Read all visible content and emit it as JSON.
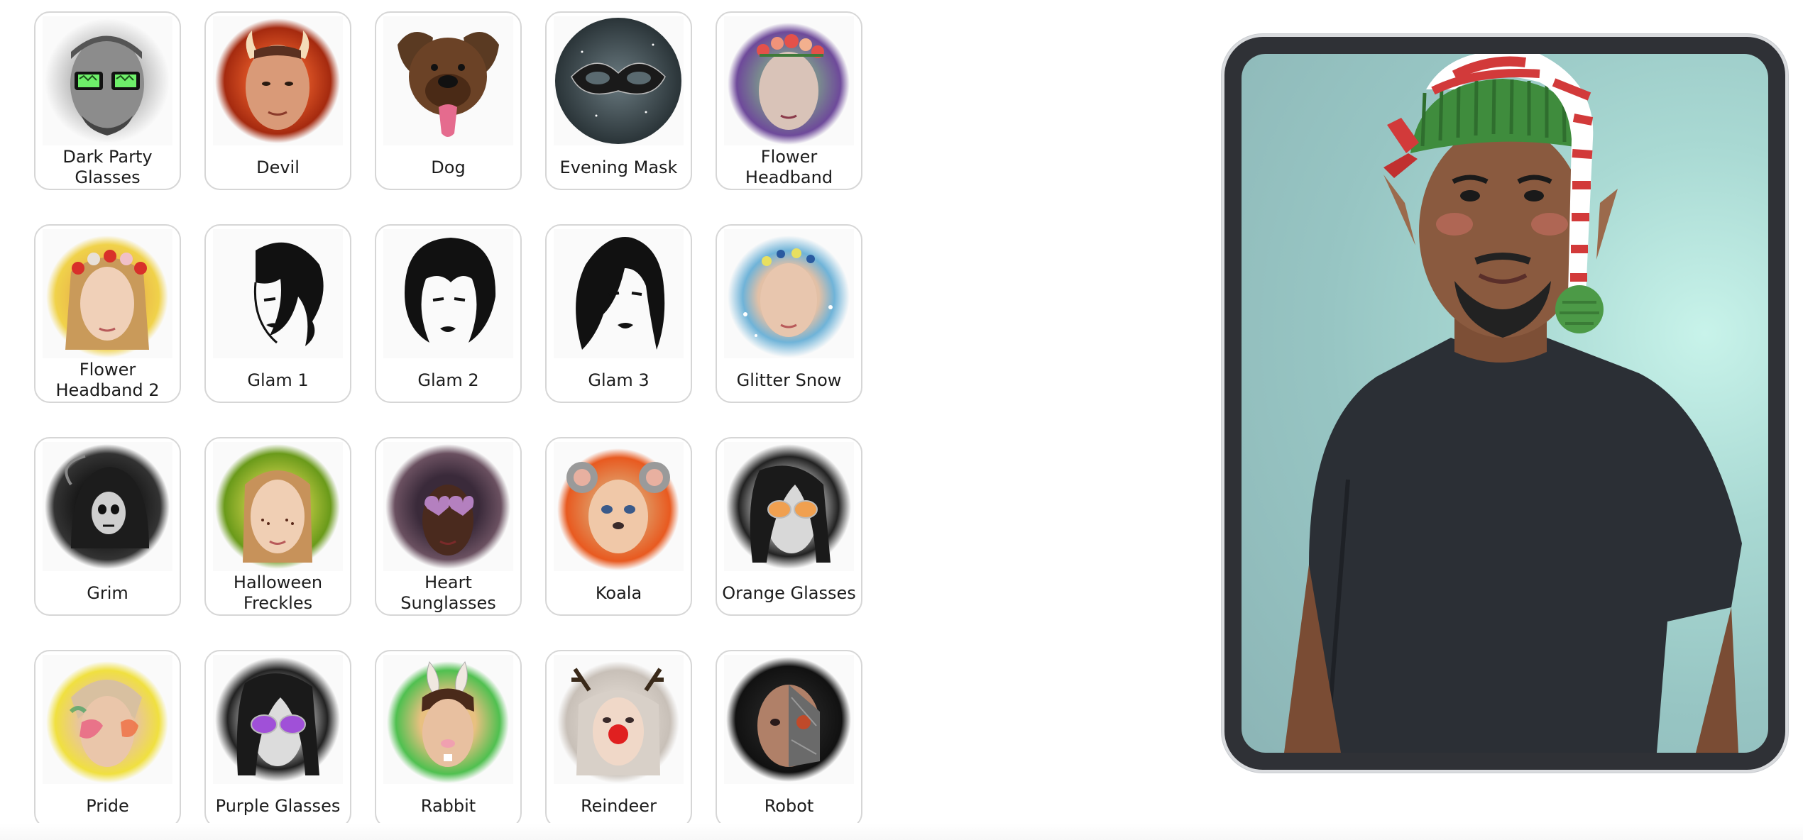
{
  "filters": [
    {
      "label": "Dark Party Glasses",
      "icon": "dark-party-glasses-icon"
    },
    {
      "label": "Devil",
      "icon": "devil-icon"
    },
    {
      "label": "Dog",
      "icon": "dog-icon"
    },
    {
      "label": "Evening Mask",
      "icon": "evening-mask-icon"
    },
    {
      "label": "Flower Headband",
      "icon": "flower-headband-icon"
    },
    {
      "label": "Flower Headband 2",
      "icon": "flower-headband-2-icon"
    },
    {
      "label": "Glam 1",
      "icon": "glam-1-icon"
    },
    {
      "label": "Glam 2",
      "icon": "glam-2-icon"
    },
    {
      "label": "Glam 3",
      "icon": "glam-3-icon"
    },
    {
      "label": "Glitter Snow",
      "icon": "glitter-snow-icon"
    },
    {
      "label": "Grim",
      "icon": "grim-icon"
    },
    {
      "label": "Halloween Freckles",
      "icon": "halloween-freckles-icon"
    },
    {
      "label": "Heart Sunglasses",
      "icon": "heart-sunglasses-icon"
    },
    {
      "label": "Koala",
      "icon": "koala-icon"
    },
    {
      "label": "Orange Glasses",
      "icon": "orange-glasses-icon"
    },
    {
      "label": "Pride",
      "icon": "pride-icon"
    },
    {
      "label": "Purple Glasses",
      "icon": "purple-glasses-icon"
    },
    {
      "label": "Rabbit",
      "icon": "rabbit-icon"
    },
    {
      "label": "Reindeer",
      "icon": "reindeer-icon"
    },
    {
      "label": "Robot",
      "icon": "robot-icon"
    }
  ],
  "preview": {
    "effect": "elf-hat",
    "colors": {
      "hat_green": "#3f8c3d",
      "hat_red": "#d23a3a",
      "shirt": "#2b2f35",
      "skin": "#8a5a3f",
      "background": "#a9d9d3"
    }
  }
}
